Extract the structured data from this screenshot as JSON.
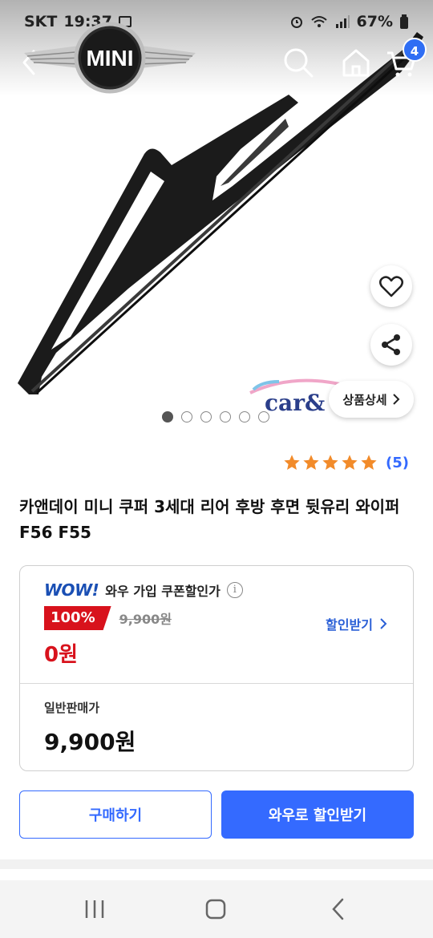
{
  "status_bar": {
    "carrier": "SKT",
    "time": "19:37",
    "battery": "67%"
  },
  "header": {
    "logo_text": "MINI",
    "cart_count": "4",
    "icons": [
      "back-icon",
      "search-icon",
      "home-icon",
      "cart-icon"
    ]
  },
  "gallery": {
    "image_count": 6,
    "active_index": 0,
    "detail_label": "상품상세",
    "watermark_text": "car&"
  },
  "rating": {
    "stars": 5,
    "count": "(5)",
    "color": "#f28b2a"
  },
  "product": {
    "title": "카앤데이 미니 쿠퍼 3세대 리어 후방 후면 뒷유리 와이퍼 F56 F55"
  },
  "price": {
    "wow_logo": "WOW!",
    "wow_label": "와우 가입 쿠폰할인가",
    "discount_rate": "100%",
    "original_price": "9,900원",
    "coupon_link": "할인받기",
    "wow_price": "0원",
    "normal_label": "일반판매가",
    "normal_price": "9,900원"
  },
  "actions": {
    "buy_label": "구매하기",
    "wow_label": "와우로 할인받기"
  },
  "colors": {
    "accent": "#346aff",
    "sale_red": "#d8121c",
    "badge_blue": "#2f6ef4"
  }
}
